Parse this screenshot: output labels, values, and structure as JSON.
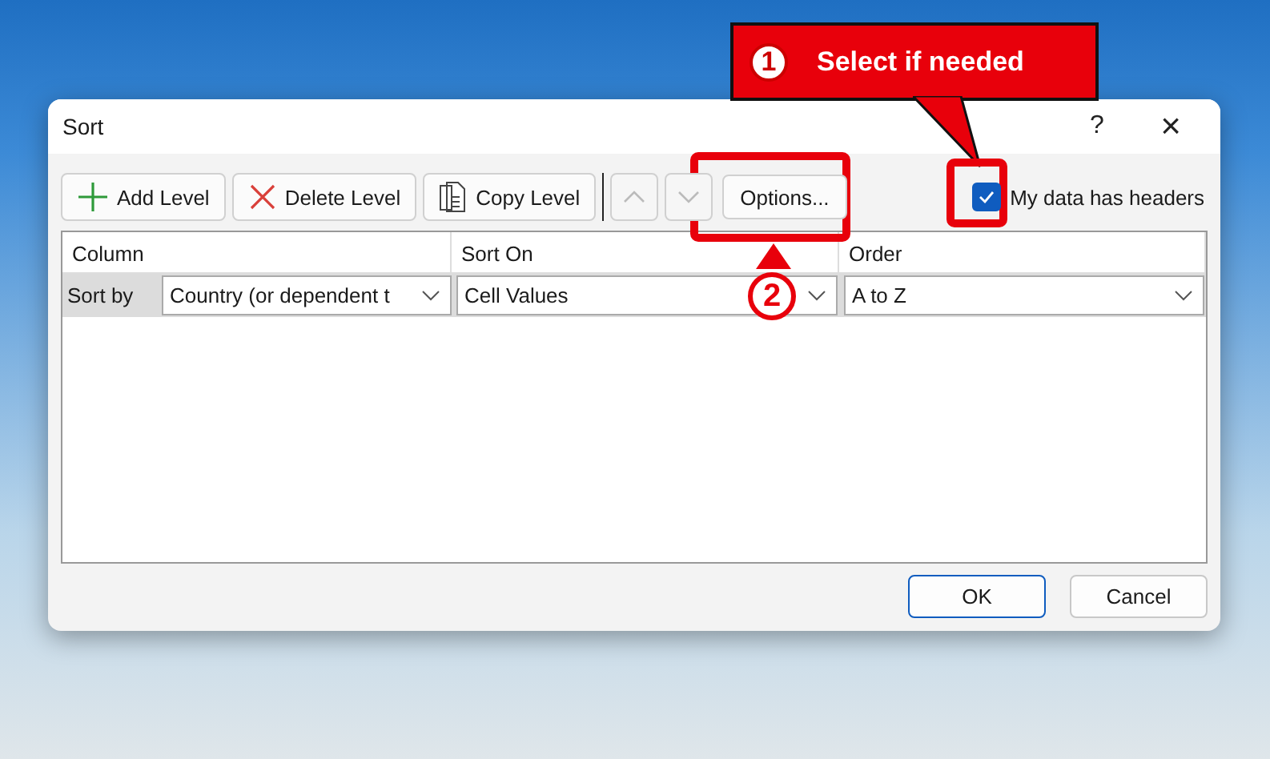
{
  "window": {
    "title": "Sort",
    "help": "?",
    "close": "×"
  },
  "toolbar": [
    {
      "kind": "add",
      "label": "Add Level",
      "disabled": false
    },
    {
      "kind": "delete",
      "label": "Delete Level",
      "disabled": false
    },
    {
      "kind": "copy",
      "label": "Copy Level",
      "disabled": false
    },
    {
      "kind": "up",
      "disabled": true
    },
    {
      "kind": "down",
      "disabled": true
    },
    {
      "kind": "options",
      "label": "Options...",
      "disabled": false
    }
  ],
  "headers_checkbox": {
    "label": "My data has headers",
    "checked": true
  },
  "grid": {
    "columns": [
      "Column",
      "Sort On",
      "Order"
    ],
    "rows": [
      {
        "label": "Sort by",
        "column": "Country (or dependent t",
        "sort_on": "Cell Values",
        "order": "A to Z",
        "selected": true
      }
    ]
  },
  "buttons": [
    {
      "label": "OK",
      "default": true
    },
    {
      "label": "Cancel",
      "default": false
    }
  ],
  "callouts": [
    {
      "number": "1",
      "text": "Select if needed"
    },
    {
      "number": "2"
    }
  ]
}
